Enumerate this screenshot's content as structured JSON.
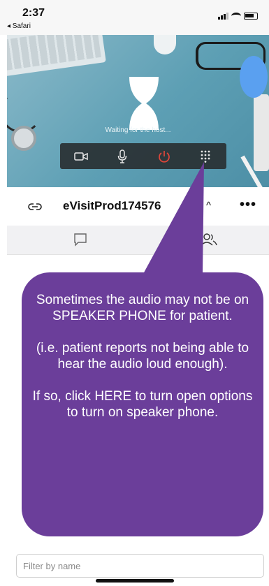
{
  "status_bar": {
    "time": "2:37",
    "back_app": "◂ Safari"
  },
  "video": {
    "waiting_text": "Waiting for the host...",
    "controls": [
      {
        "name": "camera",
        "icon": "video-camera-icon"
      },
      {
        "name": "microphone",
        "icon": "microphone-icon"
      },
      {
        "name": "end-call",
        "icon": "power-icon",
        "color": "#e0463a"
      },
      {
        "name": "keypad",
        "icon": "dialpad-icon"
      }
    ]
  },
  "header": {
    "meeting_title": "eVisitProd174576",
    "chevron": "^",
    "more": "•••"
  },
  "tabs": [
    {
      "name": "chat",
      "icon": "chat-bubble-icon"
    },
    {
      "name": "participants",
      "icon": "people-icon"
    }
  ],
  "callout": {
    "color": "#6b3e9a",
    "paragraphs": [
      "Sometimes the audio may not be on SPEAKER PHONE for patient.",
      "(i.e. patient reports not being able to hear the audio loud enough).",
      "If so, click HERE to turn open options to turn on speaker phone."
    ]
  },
  "filter": {
    "placeholder": "Filter by name",
    "value": ""
  }
}
